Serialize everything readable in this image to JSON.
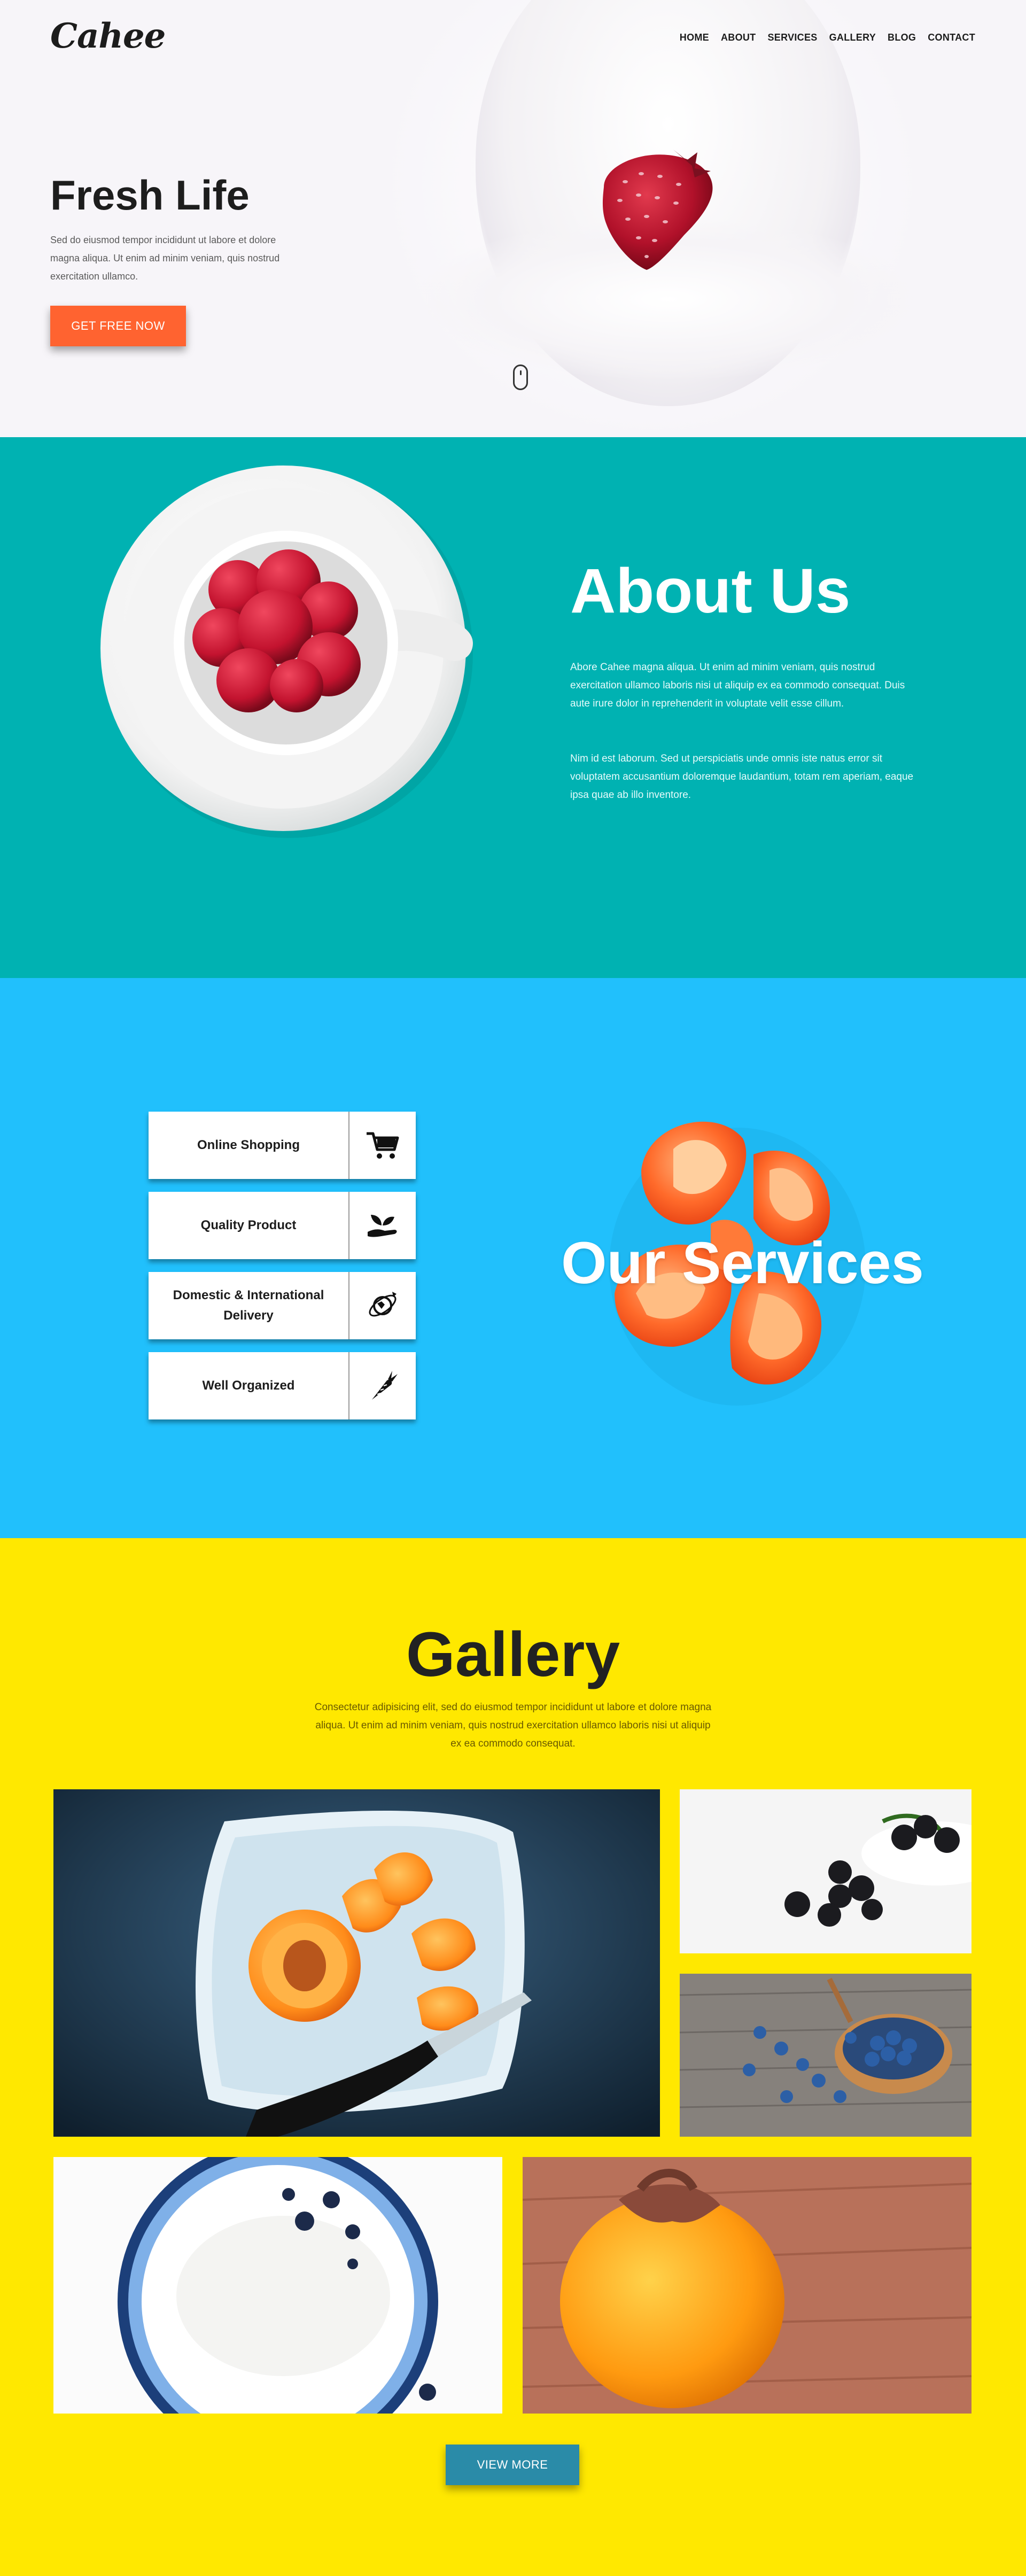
{
  "header": {
    "logo": "Cahee",
    "nav": [
      "HOME",
      "ABOUT",
      "SERVICES",
      "GALLERY",
      "BLOG",
      "CONTACT"
    ]
  },
  "hero": {
    "title": "Fresh Life",
    "text": "Sed do eiusmod tempor incididunt ut labore et dolore magna aliqua. Ut enim ad minim veniam, quis nostrud exercitation ullamco.",
    "button": "GET FREE NOW"
  },
  "about": {
    "title": "About Us",
    "paragraph1": "Abore Cahee magna aliqua. Ut enim ad minim veniam, quis nostrud exercitation ullamco laboris nisi ut aliquip ex ea commodo consequat. Duis aute irure dolor in reprehenderit in voluptate velit esse cillum.",
    "paragraph2": "Nim id est laborum. Sed ut perspiciatis unde omnis iste natus error sit voluptatem accusantium doloremque laudantium, totam rem aperiam, eaque ipsa quae ab illo inventore."
  },
  "services": {
    "title": "Our Services",
    "items": [
      {
        "label": "Online Shopping",
        "icon": "cart-icon"
      },
      {
        "label": "Quality Product",
        "icon": "hand-plant-icon"
      },
      {
        "label": "Domestic & International Delivery",
        "icon": "globe-delivery-icon"
      },
      {
        "label": "Well Organized",
        "icon": "carrot-icon"
      }
    ]
  },
  "gallery": {
    "title": "Gallery",
    "text": "Consectetur adipisicing elit, sed do eiusmod tempor incididunt ut labore et dolore magna aliqua. Ut enim ad minim veniam, quis nostrud exercitation ullamco laboris nisi ut aliquip ex ea commodo consequat.",
    "button": "VIEW MORE"
  },
  "colors": {
    "hero_bg": "#f7f5f9",
    "accent_orange": "#ff6330",
    "about_bg": "#00b2b2",
    "services_bg": "#21c0fc",
    "gallery_bg": "#ffe800",
    "view_more_bg": "#2a8ba8"
  }
}
